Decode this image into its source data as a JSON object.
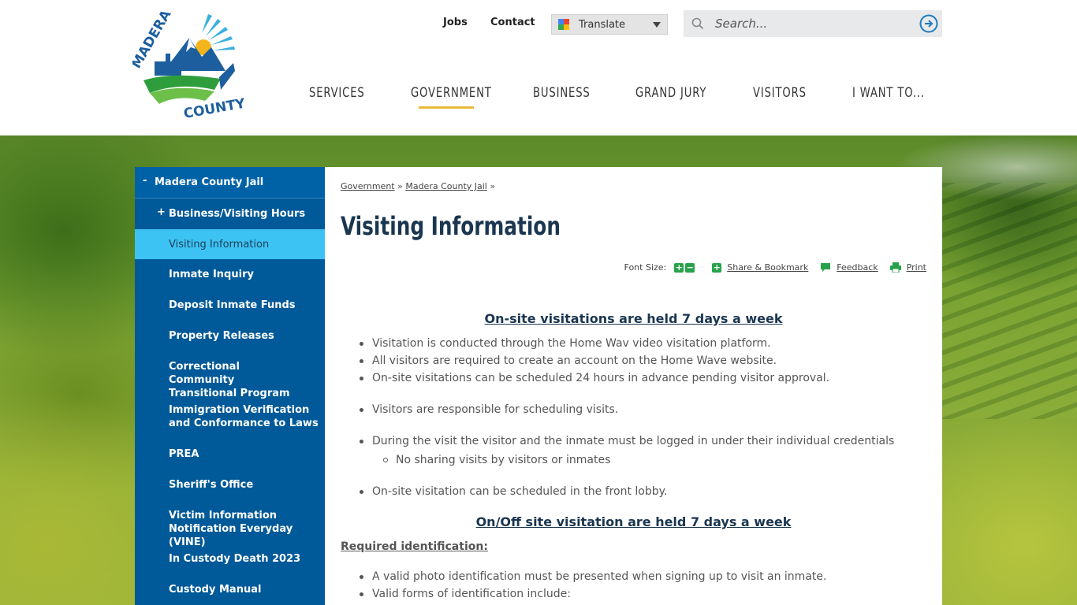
{
  "header": {
    "logo_text_top": "MADERA",
    "logo_text_bottom": "COUNTY",
    "util_links": [
      "Jobs",
      "Contact"
    ],
    "translate_label": "Translate",
    "search_placeholder": "Search...",
    "nav": [
      "SERVICES",
      "GOVERNMENT",
      "BUSINESS",
      "GRAND JURY",
      "VISITORS",
      "I WANT TO..."
    ],
    "active_nav": "GOVERNMENT"
  },
  "sidebar": {
    "top": {
      "toggle": "-",
      "label": "Madera County Jail"
    },
    "items": [
      {
        "toggle": "+",
        "label": "Business/Visiting Hours"
      },
      {
        "label": "Visiting Information"
      },
      {
        "label": "Inmate Inquiry"
      },
      {
        "label": "Deposit Inmate Funds"
      },
      {
        "label": "Property Releases"
      },
      {
        "label": "Correctional Community Transitional Program"
      },
      {
        "label": "Immigration Verification and Conformance to Laws"
      },
      {
        "label": "PREA"
      },
      {
        "label": "Sheriff's Office"
      },
      {
        "label": "Victim Information Notification Everyday (VINE)"
      },
      {
        "label": "In Custody Death 2023"
      },
      {
        "label": "Custody Manual"
      }
    ]
  },
  "content": {
    "breadcrumb": [
      "Government",
      "Madera County Jail"
    ],
    "breadcrumb_sep": "»",
    "title": "Visiting Information",
    "tools": {
      "font_size_label": "Font Size:",
      "plus": "+",
      "minus": "−",
      "share": "Share & Bookmark",
      "feedback": "Feedback",
      "print": "Print"
    },
    "heading_1": "On-site visitations are held 7 days a week",
    "bullets_1": [
      "Visitation is conducted through the Home Wav video visitation platform.",
      "All visitors are required to create an account on the Home Wave website.",
      "On-site visitations can be scheduled 24 hours in advance pending visitor approval.",
      "Visitors are responsible for scheduling visits.",
      "During the visit the visitor and the inmate must be logged in under their individual credentials",
      "On-site visitation can be scheduled in the front lobby."
    ],
    "sub_bullet": "No sharing visits by visitors or inmates",
    "heading_2": "On/Off site visitation are held 7 days a week",
    "required_id": "Required identification:",
    "bullets_2": [
      "A valid photo identification must be presented when signing up to visit an inmate.",
      "Valid forms of identification include:"
    ]
  },
  "colors": {
    "sidebar_bg": "#005998",
    "sidebar_active": "#3cc3f3",
    "nav_underline": "#e8b93a",
    "tool_green": "#27a24a",
    "title_navy": "#1a3650"
  }
}
